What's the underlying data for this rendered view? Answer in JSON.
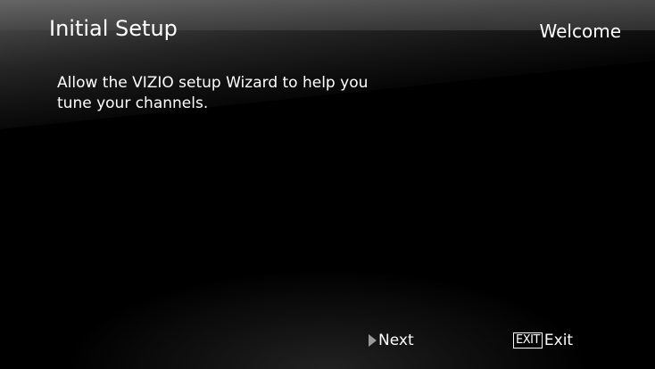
{
  "header": {
    "title": "Initial Setup",
    "step": "Welcome"
  },
  "main": {
    "message": "Allow the VIZIO setup Wizard to help you tune your channels."
  },
  "footer": {
    "next_label": "Next",
    "exit_key_label": "EXIT",
    "exit_label": "Exit"
  },
  "icons": {
    "next": "play-triangle-icon",
    "exit": "exit-key-icon"
  },
  "colors": {
    "background": "#000000",
    "text": "#ffffff",
    "sheen": "#5e5e5e"
  }
}
